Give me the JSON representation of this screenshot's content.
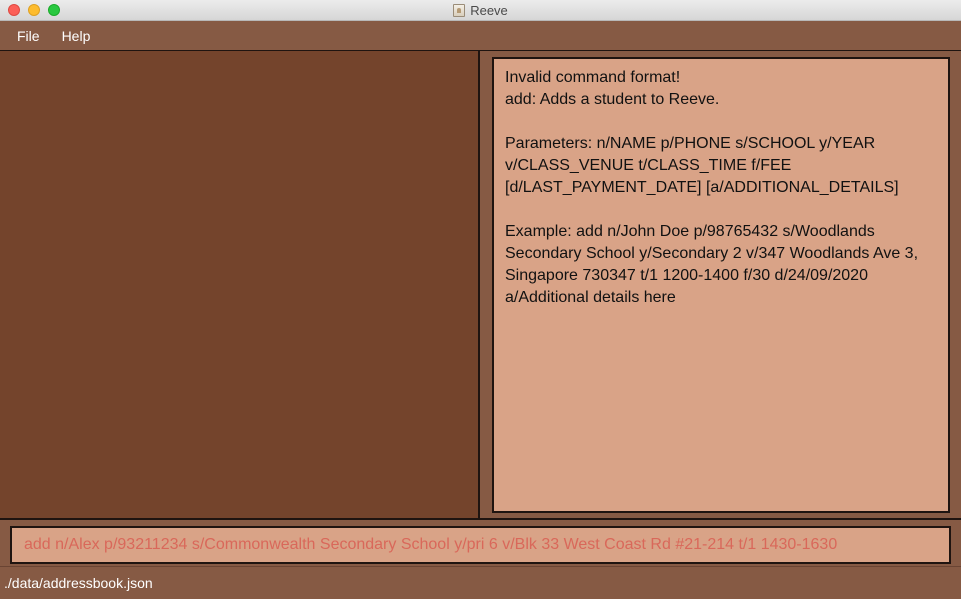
{
  "window": {
    "title": "Reeve",
    "app_icon": "reeve-app-icon"
  },
  "menu": {
    "items": [
      {
        "label": "File"
      },
      {
        "label": "Help"
      }
    ]
  },
  "result_display": {
    "text": "Invalid command format! \nadd: Adds a student to Reeve.\n\nParameters: n/NAME p/PHONE s/SCHOOL y/YEAR v/CLASS_VENUE t/CLASS_TIME f/FEE [d/LAST_PAYMENT_DATE] [a/ADDITIONAL_DETAILS]\n\nExample: add n/John Doe p/98765432 s/Woodlands Secondary School y/Secondary 2 v/347 Woodlands Ave 3, Singapore 730347 t/1 1200-1400 f/30 d/24/09/2020 a/Additional details here"
  },
  "command_box": {
    "value": "add n/Alex p/93211234 s/Commonwealth Secondary School y/pri 6 v/Blk 33 West Coast Rd #21-214 t/1 1430-1630"
  },
  "status_bar": {
    "save_location": "./data/addressbook.json"
  },
  "colors": {
    "background": "#865a44",
    "list_panel": "#74442c",
    "text_box": "#d9a387",
    "command_text_error": "#d9685a",
    "border": "#1f1410"
  }
}
